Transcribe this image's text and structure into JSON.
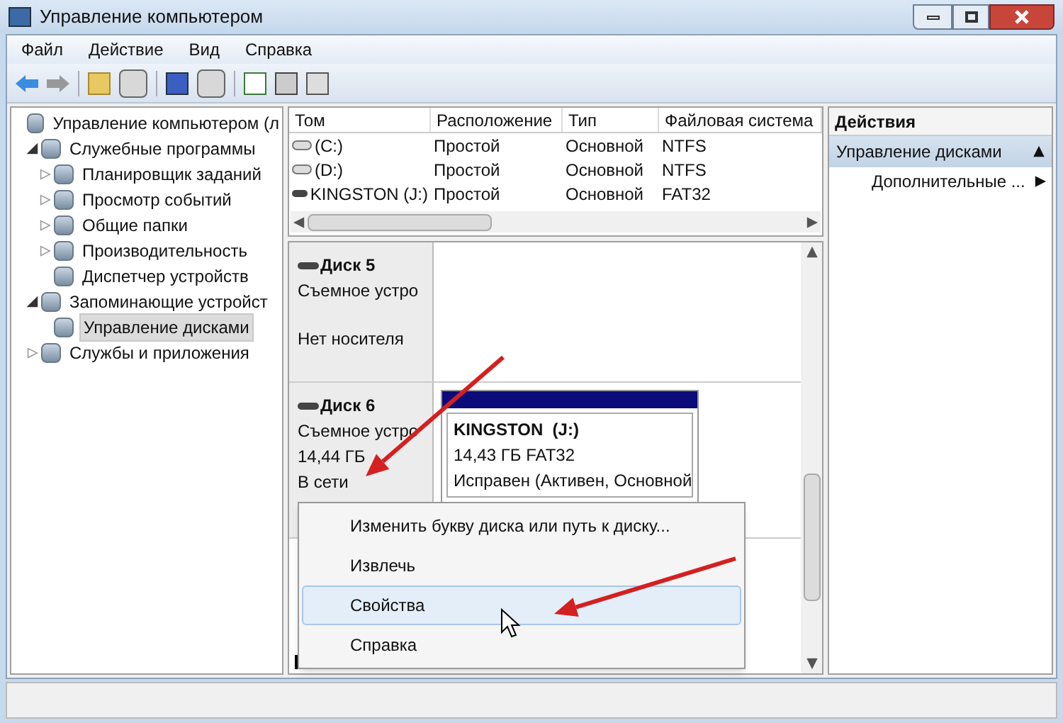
{
  "window": {
    "title": "Управление компьютером"
  },
  "menu": [
    "Файл",
    "Действие",
    "Вид",
    "Справка"
  ],
  "tree": [
    {
      "label": "Управление компьютером (л",
      "selected": false,
      "children": [
        {
          "label": "Служебные программы",
          "selected": false,
          "expanded": true,
          "children": [
            {
              "label": "Планировщик заданий",
              "selected": false,
              "expanded": false
            },
            {
              "label": "Просмотр событий",
              "selected": false,
              "expanded": false
            },
            {
              "label": "Общие папки",
              "selected": false,
              "expanded": false
            },
            {
              "label": "Производительность",
              "selected": false,
              "expanded": false
            },
            {
              "label": "Диспетчер устройств",
              "selected": false
            }
          ]
        },
        {
          "label": "Запоминающие устройст",
          "selected": false,
          "expanded": true,
          "children": [
            {
              "label": "Управление дисками",
              "selected": true
            }
          ]
        },
        {
          "label": "Службы и приложения",
          "selected": false,
          "expanded": false
        }
      ]
    }
  ],
  "volumes": {
    "columns": [
      "Том",
      "Расположение",
      "Тип",
      "Файловая система"
    ],
    "rows": [
      {
        "kind": "hdd",
        "cells": [
          "(C:)",
          "Простой",
          "Основной",
          "NTFS"
        ]
      },
      {
        "kind": "hdd",
        "cells": [
          "(D:)",
          "Простой",
          "Основной",
          "NTFS"
        ]
      },
      {
        "kind": "usb",
        "cells": [
          "KINGSTON (J:)",
          "Простой",
          "Основной",
          "FAT32"
        ]
      }
    ]
  },
  "disks": [
    {
      "name": "Диск 5",
      "type": "Съемное устро",
      "status": "Нет носителя"
    },
    {
      "name": "Диск 6",
      "type": "Съемное устро",
      "size": "14,44 ГБ",
      "status": "В сети",
      "partition": {
        "name": "KINGSTON  (J:)",
        "size": "14,43 ГБ FAT32",
        "status": "Исправен (Активен, Основной"
      }
    }
  ],
  "context_menu": [
    {
      "label": "Изменить букву диска или путь к диску...",
      "selected": false
    },
    {
      "label": "Извлечь",
      "selected": false
    },
    {
      "label": "Свойства",
      "selected": true
    },
    {
      "label": "Справка",
      "selected": false
    }
  ],
  "actions": {
    "title": "Действия",
    "section": "Управление дисками",
    "items": [
      "Дополнительные ..."
    ]
  }
}
